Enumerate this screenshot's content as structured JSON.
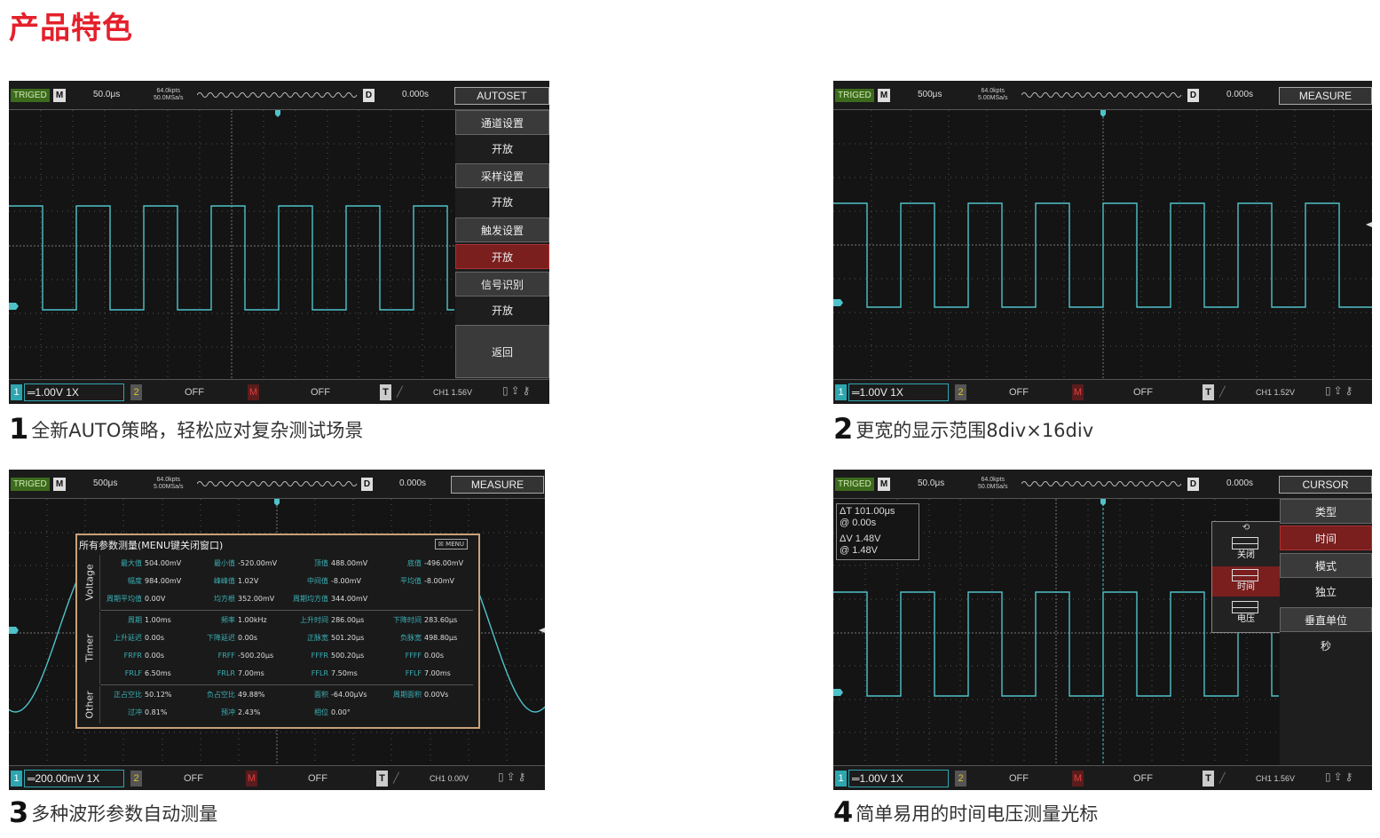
{
  "page_title": "产品特色",
  "colors": {
    "trace": "#4fc2c9",
    "accent_red": "#e4202b",
    "menu_selected": "#7a1e1e"
  },
  "panels": [
    {
      "caption_num": "1",
      "caption_text": "全新AUTO策略，轻松应对复杂测试场景",
      "top": {
        "trig": "TRIGED",
        "m": "M",
        "timebase": "50.0μs",
        "pts1": "64.0kpts",
        "pts2": "50.0MSa/s",
        "d": "D",
        "pos": "0.000s",
        "mode": "AUTOSET"
      },
      "bottom": {
        "ch1": "1",
        "scale": "═1.00V  1X",
        "ch2": "2",
        "off1": "OFF",
        "mm": "M",
        "off2": "OFF",
        "t": "T",
        "trig": "CH1 1.56V"
      },
      "menu": [
        {
          "head": "通道设置",
          "val": "开放"
        },
        {
          "head": "采样设置",
          "val": "开放"
        },
        {
          "head": "触发设置",
          "val": "开放"
        },
        {
          "head": "信号识别",
          "val": "开放"
        },
        {
          "head": "返回"
        }
      ]
    },
    {
      "caption_num": "2",
      "caption_text": "更宽的显示范围8div×16div",
      "top": {
        "trig": "TRIGED",
        "m": "M",
        "timebase": "500μs",
        "pts1": "64.0kpts",
        "pts2": "5.00MSa/s",
        "d": "D",
        "pos": "0.000s",
        "mode": "MEASURE"
      },
      "bottom": {
        "ch1": "1",
        "scale": "═1.00V  1X",
        "ch2": "2",
        "off1": "OFF",
        "mm": "M",
        "off2": "OFF",
        "t": "T",
        "trig": "CH1 1.52V"
      }
    },
    {
      "caption_num": "3",
      "caption_text": "多种波形参数自动测量",
      "top": {
        "trig": "TRIGED",
        "m": "M",
        "timebase": "500μs",
        "pts1": "64.0kpts",
        "pts2": "5.00MSa/s",
        "d": "D",
        "pos": "0.000s",
        "mode": "MEASURE"
      },
      "bottom": {
        "ch1": "1",
        "scale": "═200.00mV  1X",
        "ch2": "2",
        "off1": "OFF",
        "mm": "M",
        "off2": "OFF",
        "t": "T",
        "trig": "CH1 0.00V"
      },
      "measure": {
        "title": "所有参数测量(MENU键关闭窗口)",
        "close": "☒ MENU",
        "sections": [
          "Voltage",
          "Timer",
          "Other"
        ],
        "rows": [
          [
            [
              "最大值",
              "504.00mV"
            ],
            [
              "最小值",
              "-520.00mV"
            ],
            [
              "顶值",
              "488.00mV"
            ],
            [
              "底值",
              "-496.00mV"
            ]
          ],
          [
            [
              "幅度",
              "984.00mV"
            ],
            [
              "峰峰值",
              "1.02V"
            ],
            [
              "中间值",
              "-8.00mV"
            ],
            [
              "平均值",
              "-8.00mV"
            ]
          ],
          [
            [
              "周期平均值",
              "0.00V"
            ],
            [
              "均方根",
              "352.00mV"
            ],
            [
              "周期均方值",
              "344.00mV"
            ],
            [
              "",
              ""
            ]
          ],
          [
            [
              "周期",
              "1.00ms"
            ],
            [
              "频率",
              "1.00kHz"
            ],
            [
              "上升时间",
              "286.00μs"
            ],
            [
              "下降时间",
              "283.60μs"
            ]
          ],
          [
            [
              "上升延迟",
              "0.00s"
            ],
            [
              "下降延迟",
              "0.00s"
            ],
            [
              "正脉宽",
              "501.20μs"
            ],
            [
              "负脉宽",
              "498.80μs"
            ]
          ],
          [
            [
              "FRFR",
              "0.00s"
            ],
            [
              "FRFF",
              "-500.20μs"
            ],
            [
              "FFFR",
              "500.20μs"
            ],
            [
              "FFFF",
              "0.00s"
            ]
          ],
          [
            [
              "FRLF",
              "6.50ms"
            ],
            [
              "FRLR",
              "7.00ms"
            ],
            [
              "FFLR",
              "7.50ms"
            ],
            [
              "FFLF",
              "7.00ms"
            ]
          ],
          [
            [
              "正占空比",
              "50.12%"
            ],
            [
              "负占空比",
              "49.88%"
            ],
            [
              "面积",
              "-64.00μVs"
            ],
            [
              "周期面积",
              "0.00Vs"
            ]
          ],
          [
            [
              "过冲",
              "0.81%"
            ],
            [
              "预冲",
              "2.43%"
            ],
            [
              "相位",
              "0.00°"
            ],
            [
              "",
              ""
            ]
          ]
        ]
      }
    },
    {
      "caption_num": "4",
      "caption_text": "简单易用的时间电压测量光标",
      "top": {
        "trig": "TRIGED",
        "m": "M",
        "timebase": "50.0μs",
        "pts1": "64.0kpts",
        "pts2": "50.0MSa/s",
        "d": "D",
        "pos": "0.000s",
        "mode": "CURSOR"
      },
      "bottom": {
        "ch1": "1",
        "scale": "═1.00V  1X",
        "ch2": "2",
        "off1": "OFF",
        "mm": "M",
        "off2": "OFF",
        "t": "T",
        "trig": "CH1 1.56V"
      },
      "cursor": {
        "dt": "ΔT  101.00μs",
        "dt_at": "@  0.00s",
        "dv": "ΔV 1.48V",
        "dv_at": "@  1.48V"
      },
      "popup": [
        "关闭",
        "时间",
        "电压"
      ],
      "menu": [
        {
          "head": "类型",
          "val": "时间"
        },
        {
          "head": "模式",
          "val": "独立"
        },
        {
          "head": "垂直单位",
          "val": "秒"
        }
      ]
    }
  ]
}
